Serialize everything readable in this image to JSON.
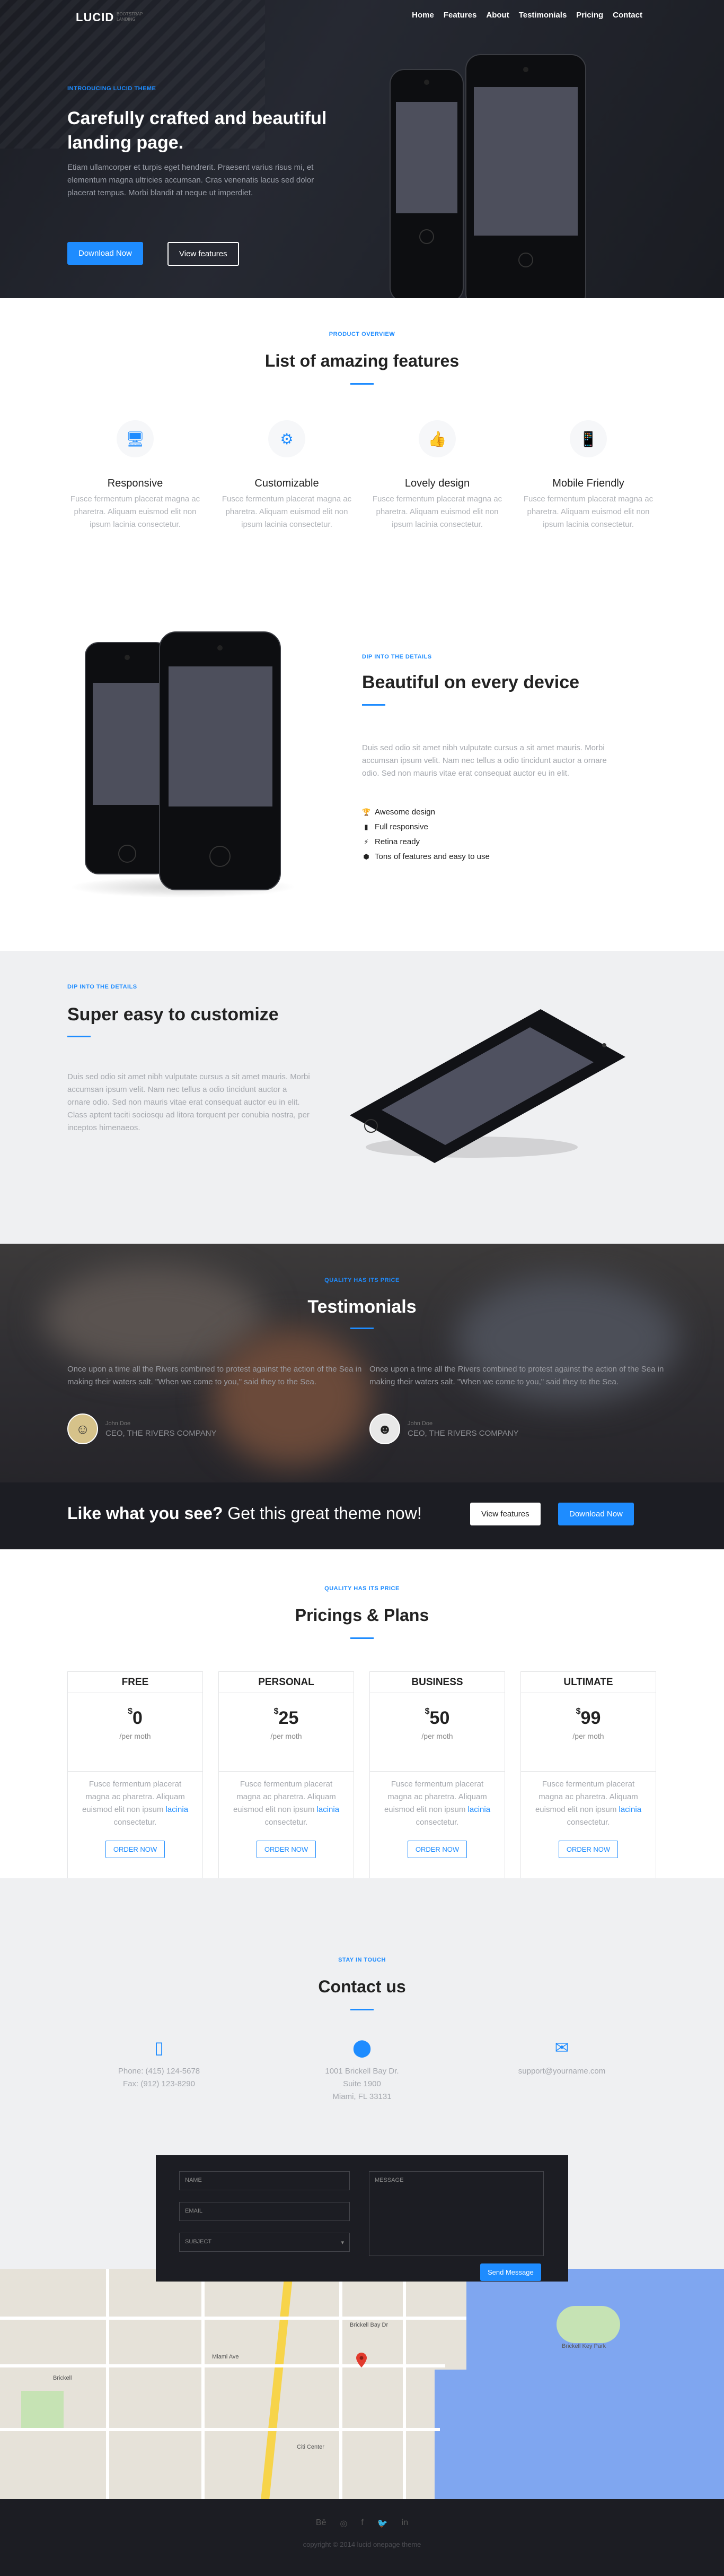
{
  "nav": {
    "logo": "LUCID",
    "logo_sub": "BOOTSTRAP LANDING",
    "links": [
      "Home",
      "Features",
      "About",
      "Testimonials",
      "Pricing",
      "Contact"
    ]
  },
  "hero": {
    "eyebrow": "INTRODUCING LUCID THEME",
    "title": "Carefully crafted and beautiful landing page.",
    "text": "Etiam ullamcorper et turpis eget hendrerit. Praesent varius risus mi, et elementum magna ultricies accumsan. Cras venenatis lacus sed dolor placerat tempus. Morbi blandit at neque ut imperdiet.",
    "btn_primary": "Download Now",
    "btn_secondary": "View features"
  },
  "features": {
    "eyebrow": "PRODUCT OVERVIEW",
    "title": "List of amazing features",
    "items": [
      {
        "icon": "desktop-icon",
        "glyph": "🖥",
        "title": "Responsive",
        "text": "Fusce fermentum placerat magna ac pharetra. Aliquam euismod elit non ipsum lacinia consectetur."
      },
      {
        "icon": "gear-icon",
        "glyph": "⚙",
        "title": "Customizable",
        "text": "Fusce fermentum placerat magna ac pharetra. Aliquam euismod elit non ipsum lacinia consectetur."
      },
      {
        "icon": "thumbs-up-icon",
        "glyph": "👍",
        "title": "Lovely design",
        "text": "Fusce fermentum placerat magna ac pharetra. Aliquam euismod elit non ipsum lacinia consectetur."
      },
      {
        "icon": "mobile-icon",
        "glyph": "📱",
        "title": "Mobile Friendly",
        "text": "Fusce fermentum placerat magna ac pharetra. Aliquam euismod elit non ipsum lacinia consectetur."
      }
    ]
  },
  "device": {
    "eyebrow": "DIP INTO THE DETAILS",
    "title": "Beautiful on every device",
    "text": "Duis sed odio sit amet nibh vulputate cursus a sit amet mauris. Morbi accumsan ipsum velit. Nam nec tellus a odio tincidunt auctor a ornare odio. Sed non mauris vitae erat consequat auctor eu in elit.",
    "list": [
      {
        "icon": "trophy-icon",
        "glyph": "🏆",
        "text": "Awesome design"
      },
      {
        "icon": "mobile-icon",
        "glyph": "▮",
        "text": "Full responsive"
      },
      {
        "icon": "bolt-icon",
        "glyph": "⚡",
        "text": "Retina ready"
      },
      {
        "icon": "cubes-icon",
        "glyph": "⬢",
        "text": "Tons of features and easy to use"
      }
    ]
  },
  "customize": {
    "eyebrow": "DIP INTO THE DETAILS",
    "title": "Super easy to customize",
    "text": "Duis sed odio sit amet nibh vulputate cursus a sit amet mauris. Morbi accumsan ipsum velit. Nam nec tellus a odio tincidunt auctor a ornare odio. Sed non mauris vitae erat consequat auctor eu in elit. Class aptent taciti sociosqu ad litora torquent per conubia nostra, per inceptos himenaeos."
  },
  "testimonials": {
    "eyebrow": "QUALITY HAS ITS PRICE",
    "title": "Testimonials",
    "items": [
      {
        "quote": "Once upon a time all the Rivers combined to protest against the action of the Sea in making their waters salt. \"When we come to you,\" said they to the Sea.",
        "name": "John Doe",
        "role": "CEO, THE RIVERS COMPANY"
      },
      {
        "quote": "Once upon a time all the Rivers combined to protest against the action of the Sea in making their waters salt. \"When we come to you,\" said they to the Sea.",
        "name": "John Doe",
        "role": "CEO, THE RIVERS COMPANY"
      }
    ]
  },
  "cta": {
    "bold": "Like what you see?",
    "rest": " Get this great theme now!",
    "btn_secondary": "View features",
    "btn_primary": "Download Now"
  },
  "pricing": {
    "eyebrow": "QUALITY HAS ITS PRICE",
    "title": "Pricings & Plans",
    "currency": "$",
    "plans": [
      {
        "name": "FREE",
        "price": "0",
        "period": "/per moth",
        "text_a": "Fusce fermentum placerat magna ac pharetra. Aliquam euismod elit non ipsum ",
        "text_link": "lacinia",
        "text_b": " consectetur.",
        "button": "ORDER NOW"
      },
      {
        "name": "PERSONAL",
        "price": "25",
        "period": "/per moth",
        "text_a": "Fusce fermentum placerat magna ac pharetra. Aliquam euismod elit non ipsum ",
        "text_link": "lacinia",
        "text_b": " consectetur.",
        "button": "ORDER NOW"
      },
      {
        "name": "BUSINESS",
        "price": "50",
        "period": "/per moth",
        "text_a": "Fusce fermentum placerat magna ac pharetra. Aliquam euismod elit non ipsum ",
        "text_link": "lacinia",
        "text_b": " consectetur.",
        "button": "ORDER NOW"
      },
      {
        "name": "ULTIMATE",
        "price": "99",
        "period": "/per moth",
        "text_a": "Fusce fermentum placerat magna ac pharetra. Aliquam euismod elit non ipsum ",
        "text_link": "lacinia",
        "text_b": " consectetur.",
        "button": "ORDER NOW"
      }
    ]
  },
  "contact": {
    "eyebrow": "STAY IN TOUCH",
    "title": "Contact us",
    "phone": {
      "icon": "phone-icon",
      "line1": "Phone: (415) 124-5678",
      "line2": "Fax: (912) 123-8290"
    },
    "address": {
      "icon": "map-marker-icon",
      "line1": "1001 Brickell Bay Dr.",
      "line2": "Suite 1900",
      "line3": "Miami, FL 33131"
    },
    "email": {
      "icon": "envelope-icon",
      "line1": "support@yourname.com"
    },
    "form": {
      "name_placeholder": "NAME",
      "email_placeholder": "EMAIL",
      "subject_placeholder": "SUBJECT",
      "message_placeholder": "MESSAGE",
      "send": "Send Message"
    }
  },
  "map": {
    "labels": [
      "Brickell Key Park",
      "Miami Ave",
      "Brickell",
      "Citi Center",
      "Brickell Bay Dr"
    ]
  },
  "footer": {
    "social": [
      {
        "icon": "behance-icon",
        "glyph": "Bē"
      },
      {
        "icon": "dribbble-icon",
        "glyph": "◎"
      },
      {
        "icon": "facebook-icon",
        "glyph": "f"
      },
      {
        "icon": "twitter-icon",
        "glyph": "🐦"
      },
      {
        "icon": "linkedin-icon",
        "glyph": "in"
      }
    ],
    "copyright": "copyright © 2014 lucid onepage theme"
  },
  "colors": {
    "accent": "#1e8cff",
    "dark": "#1c1d23",
    "light_bg": "#eff0f2"
  }
}
